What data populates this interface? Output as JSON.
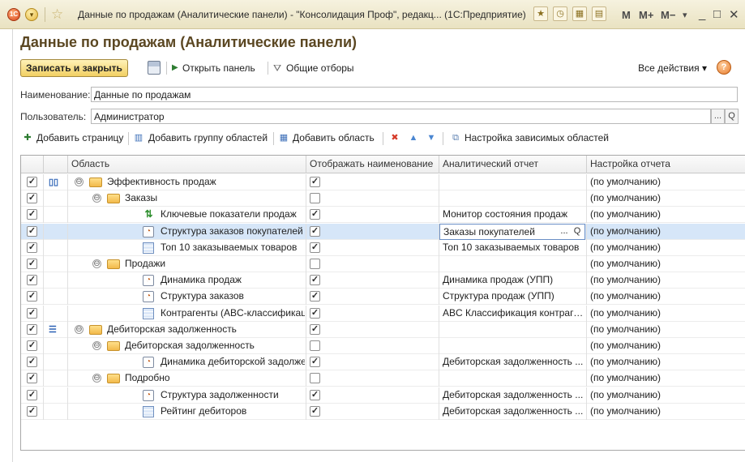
{
  "window": {
    "title": "Данные по продажам (Аналитические панели) - \"Консолидация Проф\", редакц...  (1С:Предприятие)",
    "logo_text": "1С",
    "menu_glyph": "▾",
    "star_glyph": "☆",
    "m_labels": [
      "M",
      "M+",
      "M−"
    ],
    "arrow_glyph": "▾",
    "controls": [
      "_",
      "□",
      "✕"
    ]
  },
  "form": {
    "heading": "Данные по продажам (Аналитические панели)",
    "save_close_label": "Записать и закрыть",
    "open_panel_label": "Открыть панель",
    "common_filters_label": "Общие отборы",
    "all_actions_label": "Все действия",
    "help_label": "?",
    "name_label": "Наименование:",
    "name_value": "Данные по продажам",
    "user_label": "Пользователь:",
    "user_value": "Администратор",
    "dots_glyph": "...",
    "search_glyph": "Q"
  },
  "toolbar2": {
    "add_page": "Добавить страницу",
    "add_group": "Добавить группу областей",
    "add_area": "Добавить область",
    "dependent_settings": "Настройка зависимых областей",
    "delete_glyph": "✖",
    "up_glyph": "▲",
    "down_glyph": "▼"
  },
  "grid": {
    "columns": [
      "Область",
      "Отображать наименование",
      "Аналитический отчет",
      "Настройка отчета"
    ],
    "rows": [
      {
        "area": "Эффективность продаж",
        "report": "",
        "setting": "(по умолчанию)",
        "show": true,
        "checked": true,
        "level": 0,
        "kind": "folder",
        "type": "▯▯",
        "expander": "⊖"
      },
      {
        "area": "Заказы",
        "report": "",
        "setting": "(по умолчанию)",
        "show": false,
        "checked": true,
        "level": 1,
        "kind": "folder",
        "expander": "⊖"
      },
      {
        "area": "Ключевые показатели продаж",
        "report": "Монитор состояния продаж",
        "setting": "(по умолчанию)",
        "show": true,
        "checked": true,
        "level": 2,
        "kind": "kpi"
      },
      {
        "area": "Структура заказов покупателей п...",
        "report": "Заказы покупателей",
        "setting": "(по умолчанию)",
        "show": true,
        "checked": true,
        "level": 2,
        "kind": "chart",
        "selected": true
      },
      {
        "area": "Топ 10 заказываемых товаров",
        "report": "Топ 10 заказываемых товаров",
        "setting": "(по умолчанию)",
        "show": true,
        "checked": true,
        "level": 2,
        "kind": "table"
      },
      {
        "area": "Продажи",
        "report": "",
        "setting": "(по умолчанию)",
        "show": false,
        "checked": true,
        "level": 1,
        "kind": "folder",
        "expander": "⊖"
      },
      {
        "area": "Динамика продаж",
        "report": "Динамика продаж (УПП)",
        "setting": "(по умолчанию)",
        "show": true,
        "checked": true,
        "level": 2,
        "kind": "chart"
      },
      {
        "area": "Структура заказов",
        "report": "Структура продаж (УПП)",
        "setting": "(по умолчанию)",
        "show": true,
        "checked": true,
        "level": 2,
        "kind": "chart"
      },
      {
        "area": "Контрагенты (ABC-классификация)",
        "report": "ABC Классификация контраге...",
        "setting": "(по умолчанию)",
        "show": true,
        "checked": true,
        "level": 2,
        "kind": "table"
      },
      {
        "area": "Дебиторская задолженность",
        "report": "",
        "setting": "(по умолчанию)",
        "show": true,
        "checked": true,
        "level": 0,
        "kind": "folder",
        "type": "☰",
        "expander": "⊖"
      },
      {
        "area": "Дебиторская задолженность",
        "report": "",
        "setting": "(по умолчанию)",
        "show": false,
        "checked": true,
        "level": 1,
        "kind": "folder",
        "expander": "⊖"
      },
      {
        "area": "Динамика дебиторской задолжен...",
        "report": "Дебиторская задолженность ...",
        "setting": "(по умолчанию)",
        "show": true,
        "checked": true,
        "level": 2,
        "kind": "chart"
      },
      {
        "area": "Подробно",
        "report": "",
        "setting": "(по умолчанию)",
        "show": false,
        "checked": true,
        "level": 1,
        "kind": "folder",
        "expander": "⊖"
      },
      {
        "area": "Структура задолженности",
        "report": "Дебиторская задолженность ...",
        "setting": "(по умолчанию)",
        "show": true,
        "checked": true,
        "level": 2,
        "kind": "chart"
      },
      {
        "area": "Рейтинг дебиторов",
        "report": "Дебиторская задолженность ...",
        "setting": "(по умолчанию)",
        "show": true,
        "checked": true,
        "level": 2,
        "kind": "table"
      }
    ]
  },
  "colors": {
    "accent": "#f1cf63",
    "heading": "#5b4722",
    "selected_row": "#d6e6f8"
  }
}
